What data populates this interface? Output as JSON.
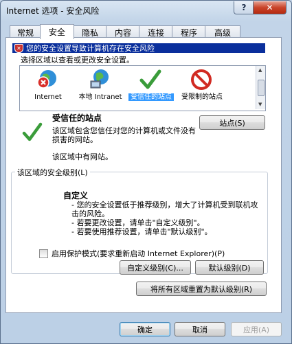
{
  "window": {
    "title": "Internet 选项 - 安全风险",
    "help_label": "?",
    "close_label": "✕"
  },
  "tabs": [
    {
      "label": "常规"
    },
    {
      "label": "安全"
    },
    {
      "label": "隐私"
    },
    {
      "label": "内容"
    },
    {
      "label": "连接"
    },
    {
      "label": "程序"
    },
    {
      "label": "高级"
    }
  ],
  "active_tab": "安全",
  "warning": {
    "text": "您的安全设置导致计算机存在安全风险",
    "color": "#0a2f9c"
  },
  "select_prompt": "选择区域以查看或更改安全设置。",
  "zones": [
    {
      "label": "Internet",
      "icon": "globe-warning-icon"
    },
    {
      "label": "本地 Intranet",
      "icon": "intranet-globe-icon"
    },
    {
      "label": "受信任的站点",
      "icon": "check-icon",
      "selected": true
    },
    {
      "label": "受限制的站点",
      "icon": "no-entry-icon"
    }
  ],
  "sites_button": "站点(S)",
  "zone_info": {
    "title": "受信任的站点",
    "description": "该区域包含您信任对您的计算机或文件没有损害的网站。",
    "no_sites": "该区域中有网站。"
  },
  "security_level": {
    "group_label": "该区域的安全级别(L)",
    "title": "自定义",
    "bullets": [
      "- 您的安全设置低于推荐级别，增大了计算机受到联机攻击的风险。",
      "- 若要更改设置，请单击\"自定义级别\"。",
      "- 若要使用推荐设置，请单击\"默认级别\"。"
    ]
  },
  "protected_mode": {
    "label": "启用保护模式(要求重新启动 Internet Explorer)(P)",
    "checked": false
  },
  "buttons": {
    "custom_level": "自定义级别(C)...",
    "default_level": "默认级别(D)",
    "reset_all": "将所有区域重置为默认级别(R)",
    "ok": "确定",
    "cancel": "取消",
    "apply": "应用(A)"
  }
}
